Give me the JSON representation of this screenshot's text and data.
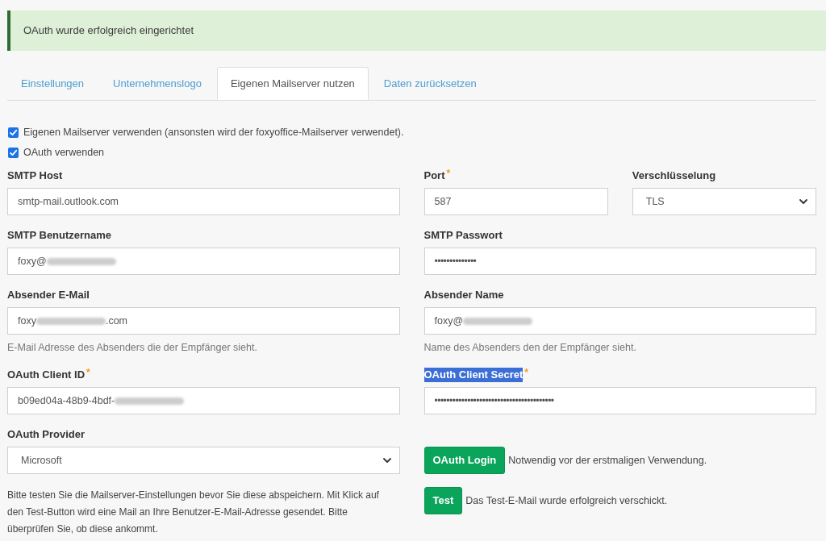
{
  "alert": {
    "kind": "success",
    "text": "OAuth wurde erfolgreich eingerichtet"
  },
  "tabs": [
    {
      "label": "Einstellungen",
      "selected": false
    },
    {
      "label": "Unternehmenslogo",
      "selected": false
    },
    {
      "label": "Eigenen Mailserver nutzen",
      "selected": true
    },
    {
      "label": "Daten zurücksetzen",
      "selected": false
    }
  ],
  "checkboxes": [
    {
      "label": "Eigenen Mailserver verwenden (ansonsten wird der foxyoffice-Mailserver verwendet).",
      "checked": true
    },
    {
      "label": "OAuth verwenden",
      "checked": true
    }
  ],
  "form_rows": [
    {
      "fields": [
        {
          "kind": "text",
          "label": "SMTP Host",
          "label_highlighted": false,
          "value": "smtp-mail.outlook.com",
          "redacted": false
        },
        {
          "kind": "text",
          "label": "Port",
          "required_mark": "*",
          "label_highlighted": false,
          "value": "587",
          "redacted": false
        },
        {
          "kind": "select",
          "label": "Verschlüsselung",
          "label_highlighted": false,
          "value": "TLS"
        }
      ]
    },
    {
      "fields": [
        {
          "kind": "text",
          "label": "SMTP Benutzername",
          "label_highlighted": false,
          "value": "foxy@",
          "redacted": true
        },
        {
          "kind": "password",
          "label": "SMTP Passwort",
          "label_highlighted": false,
          "value": "••••••••••••••"
        }
      ]
    },
    {
      "fields": [
        {
          "kind": "text",
          "label": "Absender E-Mail",
          "label_highlighted": false,
          "value": "foxy",
          "redacted": true,
          "value_suffix": ".com",
          "help": "E-Mail Adresse des Absenders die der Empfänger sieht."
        },
        {
          "kind": "text",
          "label": "Absender Name",
          "label_highlighted": false,
          "value": "foxy@",
          "redacted": true,
          "help": "Name des Absenders den der Empfänger sieht."
        }
      ]
    },
    {
      "fields": [
        {
          "kind": "text",
          "label": "OAuth Client ID",
          "required_mark": "*",
          "label_highlighted": false,
          "value": "b09ed04a-48b9-4bdf-",
          "redacted": true
        },
        {
          "kind": "password",
          "label": "OAuth Client Secret",
          "required_mark": "*",
          "label_highlighted": true,
          "value": "••••••••••••••••••••••••••••••••••••••••"
        }
      ]
    }
  ],
  "oauth": {
    "provider": {
      "label": "OAuth Provider",
      "label_highlighted": false,
      "value": "Microsoft"
    },
    "notice": "Bitte testen Sie die Mailserver-Einstellungen bevor Sie diese abspeichern. Mit Klick auf den Test-Button wird eine Mail an Ihre Benutzer-E-Mail-Adresse gesendet. Bitte überprüfen Sie, ob diese ankommt.",
    "actions": [
      {
        "label": "OAuth Login",
        "note": "Notwendig vor der erstmaligen Verwendung."
      },
      {
        "label": "Test",
        "note": "Das Test-E-Mail wurde erfolgreich verschickt."
      }
    ]
  }
}
